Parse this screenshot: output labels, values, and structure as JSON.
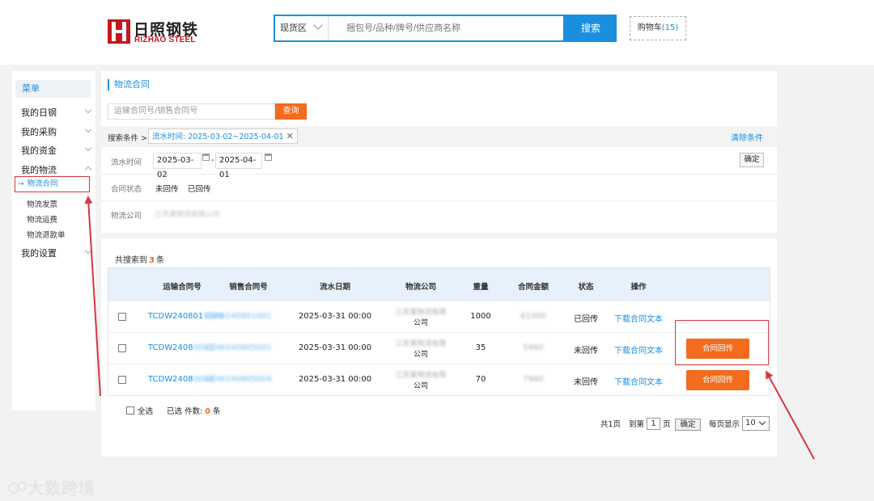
{
  "header": {
    "logo_cn": "日照钢铁",
    "logo_en": "RIZHAO STEEL",
    "search_scope": "现货区",
    "search_placeholder": "捆包号/品种/牌号/供应商名称",
    "search_button": "搜索",
    "cart_label": "购物车",
    "cart_count": "(15)"
  },
  "sidebar": {
    "title": "菜单",
    "items": [
      {
        "label": "我的日钢"
      },
      {
        "label": "我的采购"
      },
      {
        "label": "我的资金"
      },
      {
        "label": "我的物流"
      }
    ],
    "active_sub": "物流合同",
    "subs": [
      {
        "label": "物流发票"
      },
      {
        "label": "物流运费"
      },
      {
        "label": "物流退款单"
      }
    ],
    "settings": "我的设置"
  },
  "main": {
    "title": "物流合同",
    "contract_placeholder": "运输合同号/销售合同号",
    "query_button": "查询",
    "cond_label": "搜索条件 >",
    "cond_tag": "流水时间: 2025-03-02~2025-04-01",
    "clear": "清除条件",
    "filter_time_label": "流水时间",
    "date_from": "2025-03-02",
    "date_sep": "-",
    "date_to": "2025-04-01",
    "confirm": "确定",
    "status_label": "合同状态",
    "status_opt1": "未回传",
    "status_opt2": "已回传",
    "company_label": "物流公司",
    "company_value": "江苏某物流有限公司"
  },
  "results": {
    "prefix": "共搜索到",
    "count": "3",
    "suffix": "条",
    "columns": [
      "运输合同号",
      "销售合同号",
      "流水日期",
      "物流公司",
      "重量",
      "合同金额",
      "状态",
      "操作"
    ],
    "rows": [
      {
        "transport_no": "TCDW240801",
        "transport_blur": "0001",
        "sales_no": "CDW240801001",
        "date": "2025-03-31 00:00",
        "company_blur": "江苏某物流有限",
        "company_suffix": "公司",
        "weight": "1000",
        "amount": "61000",
        "status": "已回传",
        "action": "下载合同文本",
        "button": ""
      },
      {
        "transport_no": "TCDW2408",
        "transport_blur": "0001",
        "sales_no": "CDW240805001",
        "date": "2025-03-31 00:00",
        "company_blur": "江苏某物流有限",
        "company_suffix": "公司",
        "weight": "35",
        "amount": "5460",
        "status": "未回传",
        "action": "下载合同文本",
        "button": "合同回传"
      },
      {
        "transport_no": "TCDW2408",
        "transport_blur": "0004",
        "sales_no": "CDW240805004",
        "date": "2025-03-31 00:00",
        "company_blur": "江苏某物流有限",
        "company_suffix": "公司",
        "weight": "70",
        "amount": "7980",
        "status": "未回传",
        "action": "下载合同文本",
        "button": "合同回传"
      }
    ],
    "select_all": "全选",
    "selected_label": "已选 件数:",
    "selected_count": "0",
    "selected_unit": "条",
    "total_pages": "共1页",
    "goto_label": "到第",
    "page_input": "1",
    "page_unit": "页",
    "goto_button": "确定",
    "per_page_label": "每页显示",
    "per_page": "10"
  },
  "watermark": "大数跨境",
  "colors": {
    "accent": "#1a8fe0",
    "orange": "#f36b1c",
    "annotation": "#d9363e"
  }
}
